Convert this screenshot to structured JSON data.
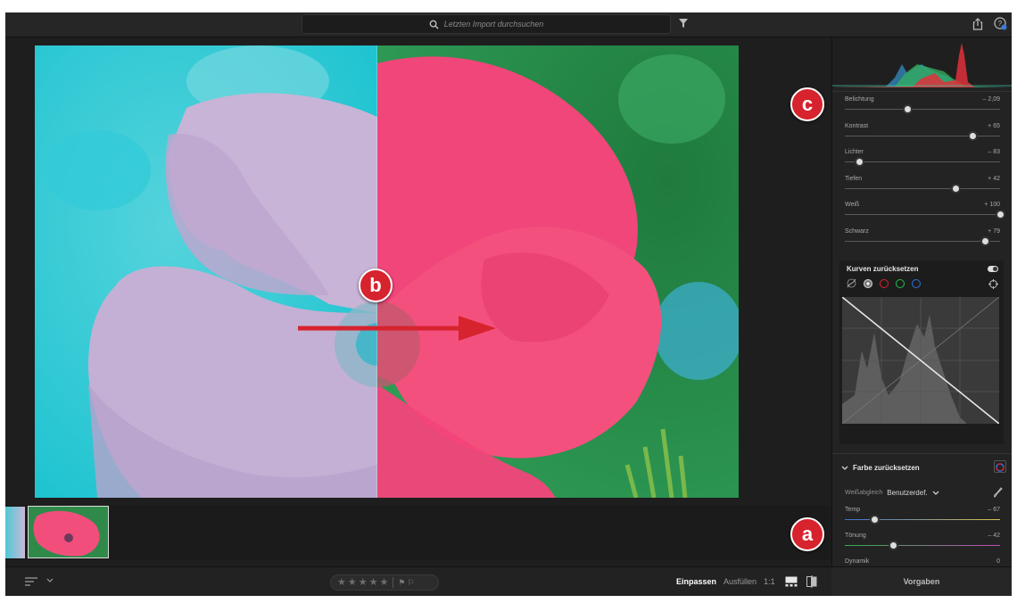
{
  "topbar": {
    "search_placeholder": "Letzten Import durchsuchen",
    "icons": [
      "search-icon",
      "filter-icon",
      "share-icon",
      "help-icon"
    ]
  },
  "photo": {
    "before_after_split_percent": 48.7
  },
  "annotations": {
    "a": "a",
    "b": "b",
    "c": "c"
  },
  "light_panel": {
    "sliders": [
      {
        "label": "Belichtung",
        "value": "– 2,09",
        "position": 0.4
      },
      {
        "label": "Kontrast",
        "value": "+ 65",
        "position": 0.82
      },
      {
        "label": "Lichter",
        "value": "– 83",
        "position": 0.09
      },
      {
        "label": "Tiefen",
        "value": "+ 42",
        "position": 0.71
      },
      {
        "label": "Weiß",
        "value": "+ 100",
        "position": 1.0
      },
      {
        "label": "Schwarz",
        "value": "+ 79",
        "position": 0.9
      }
    ]
  },
  "curve_panel": {
    "title": "Kurven zurücksetzen",
    "channels": [
      "parametric-icon",
      "rgb-channel",
      "red-channel",
      "green-channel",
      "blue-channel"
    ],
    "colors": {
      "white": "#d8d8d8",
      "red": "#e0222b",
      "green": "#20c04a",
      "blue": "#2f6fe0"
    }
  },
  "color_panel": {
    "title": "Farbe zurücksetzen",
    "wb_label": "Weißabgleich",
    "wb_value": "Benutzerdef.",
    "sliders": [
      {
        "label": "Temp",
        "value": "– 67",
        "position": 0.19
      },
      {
        "label": "Tönung",
        "value": "– 42",
        "position": 0.31
      },
      {
        "label": "Dynamik",
        "value": "0",
        "position": 0.5
      }
    ]
  },
  "bottombar": {
    "view_modes": [
      "Einpassen",
      "Ausfüllen",
      "1:1"
    ],
    "active_view": "Einpassen",
    "stars": [
      "★",
      "★",
      "★",
      "★",
      "★"
    ],
    "flags": [
      "⚑",
      "⚐"
    ]
  },
  "presets": {
    "label": "Vorgaben"
  },
  "accent_color": "#d6232e"
}
